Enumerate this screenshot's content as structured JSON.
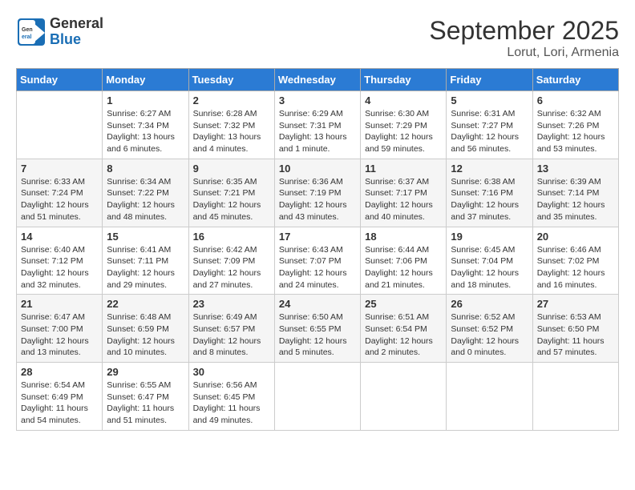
{
  "header": {
    "logo_general": "General",
    "logo_blue": "Blue",
    "month": "September 2025",
    "location": "Lorut, Lori, Armenia"
  },
  "columns": [
    "Sunday",
    "Monday",
    "Tuesday",
    "Wednesday",
    "Thursday",
    "Friday",
    "Saturday"
  ],
  "weeks": [
    [
      {
        "day": "",
        "text": ""
      },
      {
        "day": "1",
        "text": "Sunrise: 6:27 AM\nSunset: 7:34 PM\nDaylight: 13 hours\nand 6 minutes."
      },
      {
        "day": "2",
        "text": "Sunrise: 6:28 AM\nSunset: 7:32 PM\nDaylight: 13 hours\nand 4 minutes."
      },
      {
        "day": "3",
        "text": "Sunrise: 6:29 AM\nSunset: 7:31 PM\nDaylight: 13 hours\nand 1 minute."
      },
      {
        "day": "4",
        "text": "Sunrise: 6:30 AM\nSunset: 7:29 PM\nDaylight: 12 hours\nand 59 minutes."
      },
      {
        "day": "5",
        "text": "Sunrise: 6:31 AM\nSunset: 7:27 PM\nDaylight: 12 hours\nand 56 minutes."
      },
      {
        "day": "6",
        "text": "Sunrise: 6:32 AM\nSunset: 7:26 PM\nDaylight: 12 hours\nand 53 minutes."
      }
    ],
    [
      {
        "day": "7",
        "text": "Sunrise: 6:33 AM\nSunset: 7:24 PM\nDaylight: 12 hours\nand 51 minutes."
      },
      {
        "day": "8",
        "text": "Sunrise: 6:34 AM\nSunset: 7:22 PM\nDaylight: 12 hours\nand 48 minutes."
      },
      {
        "day": "9",
        "text": "Sunrise: 6:35 AM\nSunset: 7:21 PM\nDaylight: 12 hours\nand 45 minutes."
      },
      {
        "day": "10",
        "text": "Sunrise: 6:36 AM\nSunset: 7:19 PM\nDaylight: 12 hours\nand 43 minutes."
      },
      {
        "day": "11",
        "text": "Sunrise: 6:37 AM\nSunset: 7:17 PM\nDaylight: 12 hours\nand 40 minutes."
      },
      {
        "day": "12",
        "text": "Sunrise: 6:38 AM\nSunset: 7:16 PM\nDaylight: 12 hours\nand 37 minutes."
      },
      {
        "day": "13",
        "text": "Sunrise: 6:39 AM\nSunset: 7:14 PM\nDaylight: 12 hours\nand 35 minutes."
      }
    ],
    [
      {
        "day": "14",
        "text": "Sunrise: 6:40 AM\nSunset: 7:12 PM\nDaylight: 12 hours\nand 32 minutes."
      },
      {
        "day": "15",
        "text": "Sunrise: 6:41 AM\nSunset: 7:11 PM\nDaylight: 12 hours\nand 29 minutes."
      },
      {
        "day": "16",
        "text": "Sunrise: 6:42 AM\nSunset: 7:09 PM\nDaylight: 12 hours\nand 27 minutes."
      },
      {
        "day": "17",
        "text": "Sunrise: 6:43 AM\nSunset: 7:07 PM\nDaylight: 12 hours\nand 24 minutes."
      },
      {
        "day": "18",
        "text": "Sunrise: 6:44 AM\nSunset: 7:06 PM\nDaylight: 12 hours\nand 21 minutes."
      },
      {
        "day": "19",
        "text": "Sunrise: 6:45 AM\nSunset: 7:04 PM\nDaylight: 12 hours\nand 18 minutes."
      },
      {
        "day": "20",
        "text": "Sunrise: 6:46 AM\nSunset: 7:02 PM\nDaylight: 12 hours\nand 16 minutes."
      }
    ],
    [
      {
        "day": "21",
        "text": "Sunrise: 6:47 AM\nSunset: 7:00 PM\nDaylight: 12 hours\nand 13 minutes."
      },
      {
        "day": "22",
        "text": "Sunrise: 6:48 AM\nSunset: 6:59 PM\nDaylight: 12 hours\nand 10 minutes."
      },
      {
        "day": "23",
        "text": "Sunrise: 6:49 AM\nSunset: 6:57 PM\nDaylight: 12 hours\nand 8 minutes."
      },
      {
        "day": "24",
        "text": "Sunrise: 6:50 AM\nSunset: 6:55 PM\nDaylight: 12 hours\nand 5 minutes."
      },
      {
        "day": "25",
        "text": "Sunrise: 6:51 AM\nSunset: 6:54 PM\nDaylight: 12 hours\nand 2 minutes."
      },
      {
        "day": "26",
        "text": "Sunrise: 6:52 AM\nSunset: 6:52 PM\nDaylight: 12 hours\nand 0 minutes."
      },
      {
        "day": "27",
        "text": "Sunrise: 6:53 AM\nSunset: 6:50 PM\nDaylight: 11 hours\nand 57 minutes."
      }
    ],
    [
      {
        "day": "28",
        "text": "Sunrise: 6:54 AM\nSunset: 6:49 PM\nDaylight: 11 hours\nand 54 minutes."
      },
      {
        "day": "29",
        "text": "Sunrise: 6:55 AM\nSunset: 6:47 PM\nDaylight: 11 hours\nand 51 minutes."
      },
      {
        "day": "30",
        "text": "Sunrise: 6:56 AM\nSunset: 6:45 PM\nDaylight: 11 hours\nand 49 minutes."
      },
      {
        "day": "",
        "text": ""
      },
      {
        "day": "",
        "text": ""
      },
      {
        "day": "",
        "text": ""
      },
      {
        "day": "",
        "text": ""
      }
    ]
  ]
}
